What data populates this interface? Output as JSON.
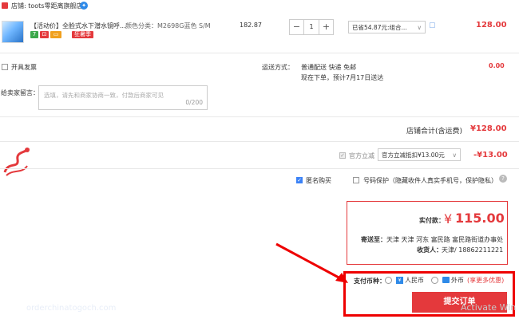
{
  "store": {
    "label": "店铺: toots零距离旗舰店"
  },
  "product": {
    "title": "【活动价】全脸式水下潜水镜呼...",
    "spec": "颜色分类：M2698G蓝色 S/M",
    "promo_badge": "狂暑季",
    "unit_price": "182.87",
    "quantity": "1",
    "discount_select": "已省54.87元:组合...",
    "subtotal": "128.00",
    "badge_colors": [
      "#3aa84a",
      "#e4393c",
      "#f0a01e"
    ]
  },
  "invoice": {
    "label": "开具发票"
  },
  "shipping": {
    "label": "运送方式：",
    "method": "普通配送 快递 免邮",
    "eta": "现在下单，预计7月17日送达",
    "fee": "0.00"
  },
  "message": {
    "label": "给卖家留言：",
    "placeholder": "选填，请先和商家协商一致，付款后商家可见",
    "counter": "0/200"
  },
  "store_total": {
    "label": "店铺合计(含运费)",
    "value": "¥128.00"
  },
  "discount": {
    "label": "官方立减",
    "select": "官方立减抵扣¥13.00元",
    "value": "-¥13.00"
  },
  "anonymous": {
    "label": "匿名购买"
  },
  "privacy": {
    "label": "号码保护（隐藏收件人真实手机号，保护隐私）"
  },
  "summary": {
    "pay_label": "实付款：",
    "currency": "¥",
    "amount": "115.00",
    "ship_to_label": "寄送至：",
    "ship_to": "天津 天津 河东 富民路 富民路街道办事处",
    "recipient_label": "收货人：",
    "recipient": "天津/ 18862211221"
  },
  "payment": {
    "label": "支付币种：",
    "option_rmb": "人民币",
    "option_foreign": "外币",
    "note": "(享更多优惠)",
    "submit": "提交订单"
  },
  "watermark": {
    "text": "orderchinatogoch.com",
    "activate": "Activate Win"
  },
  "colors": {
    "accent": "#e4393c",
    "highlight": "#ee0000",
    "check": "#3b82f6"
  }
}
